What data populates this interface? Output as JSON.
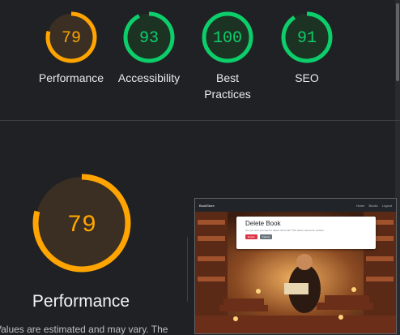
{
  "gauges": [
    {
      "score": 79,
      "label": "Performance",
      "color": "#ffa400",
      "bg": "#3a2f22"
    },
    {
      "score": 93,
      "label": "Accessibility",
      "color": "#0cce6b",
      "bg": "#1c3324"
    },
    {
      "score": 100,
      "label": "Best Practices",
      "color": "#0cce6b",
      "bg": "#1c3324"
    },
    {
      "score": 91,
      "label": "SEO",
      "color": "#0cce6b",
      "bg": "#1c3324"
    }
  ],
  "main_gauge": {
    "score": 79,
    "label": "Performance",
    "color": "#ffa400",
    "bg": "#3a2f22"
  },
  "note": "Values are estimated and may vary. The",
  "screenshot": {
    "brand": "BookStore",
    "nav_links": [
      "Home",
      "Books",
      "Logout"
    ],
    "modal_title": "Delete Book",
    "modal_text": "Are you sure you want to delete this book? This action cannot be undone.",
    "delete_label": "Delete",
    "cancel_label": "Cancel"
  }
}
